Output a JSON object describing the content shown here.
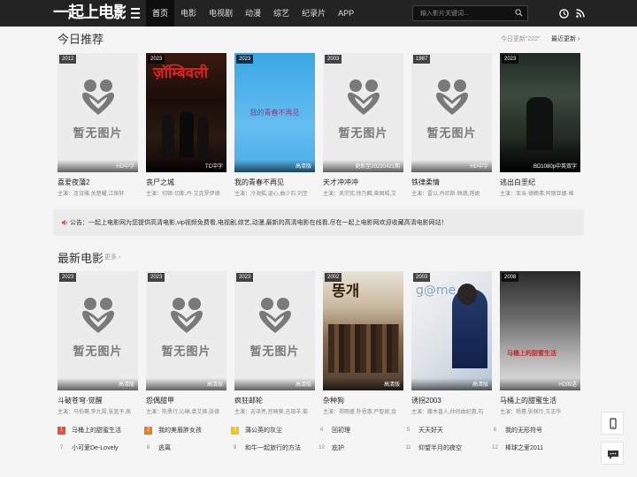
{
  "header": {
    "logo": "一起上电影",
    "nav": [
      "首页",
      "电影",
      "电视剧",
      "动漫",
      "综艺",
      "纪录片",
      "APP"
    ],
    "search_placeholder": "输入影片关键词..."
  },
  "today": {
    "title": "今日推荐",
    "hint": "今日更新\"222\"",
    "latest_link": "最近更新 ›",
    "cards": [
      {
        "year": "2012",
        "quality": "HD中字",
        "title": "喜爱夜蒲2",
        "cast": "主演：连诗雅,关楚耀,江佩轩",
        "poster": "none"
      },
      {
        "year": "2023",
        "quality": "TC中字",
        "title": "丧尸之城",
        "cast": "主演：切顿·切斯,丹·艾克罗伊德",
        "poster": "dark"
      },
      {
        "year": "2023",
        "quality": "高清版",
        "title": "我的青春不再见",
        "cast": "主演：冷海狐,温心,曲少石,刘至",
        "poster": "blue",
        "poster_text": "我的青春不再见"
      },
      {
        "year": "2003",
        "quality": "更新至20230421期",
        "title": "天才冲冲冲",
        "cast": "主演：吴宗宪,徐乃麟,曾国城,艾",
        "poster": "none"
      },
      {
        "year": "1987",
        "quality": "HD中字",
        "title": "铁律柔情",
        "cast": "主演：雷以,丹尼斯·佩德,莲妮",
        "poster": "none"
      },
      {
        "year": "2023",
        "quality": "BD1080p中英双字",
        "title": "逃出白垩纪",
        "cast": "主演：亚当·德赖弗,阿丽亚娜·格",
        "poster": "jungle"
      }
    ]
  },
  "notice": "公告：一起上电影网为您提供高清电影,vip视频免费看,电视剧,综艺,动漫,最新的高清电影在线看,尽在一起上电影网欢迎收藏高清电影网站！",
  "latest": {
    "title": "最新电影",
    "more": "更多 ›",
    "cards": [
      {
        "year": "2023",
        "quality": "高清版",
        "title": "斗破苍穹·觉醒",
        "cast": "主演：马伯骞,李九霄,张蓝予,高",
        "poster": "none"
      },
      {
        "year": "2023",
        "quality": "高清版",
        "title": "怨偶甜甲",
        "cast": "主演：陈勇行,沁琳,袁艾姬,张德",
        "poster": "none"
      },
      {
        "year": "2023",
        "quality": "高清版",
        "title": "疯狂邮轮",
        "cast": "主演：吉泽亮,宫崎葵,吉田羊,菊",
        "poster": "none"
      },
      {
        "year": "2002",
        "quality": "高清版",
        "title": "杂种狗",
        "cast": "主演：郑雨盛,朴恩惠,严智妮,金",
        "poster": "crowd",
        "poster_text": "똥개"
      },
      {
        "year": "2003",
        "quality": "高清版",
        "title": "诱拐2003",
        "cast": "主演：藤木直人,仲间由纪惠,石",
        "poster": "white",
        "poster_text": "g@me."
      },
      {
        "year": "2008",
        "quality": "HD国语",
        "title": "马桶上的甜蜜生活",
        "cast": "主演：杨蕙,张佩玲,王志华",
        "poster": "old",
        "poster_text": "马桶上的甜蜜生活"
      }
    ]
  },
  "noimg_text": "暂无图片",
  "ranking": [
    {
      "num": "1",
      "label": "马桶上的甜蜜生活",
      "color": "#e74c3c"
    },
    {
      "num": "2",
      "label": "我的美眉胖女孩",
      "color": "#e67e22"
    },
    {
      "num": "3",
      "label": "蒲公英的灰尘",
      "color": "#f1c40f"
    },
    {
      "num": "4",
      "label": "回初理",
      "color": ""
    },
    {
      "num": "5",
      "label": "天天好天",
      "color": ""
    },
    {
      "num": "6",
      "label": "我的无形符号",
      "color": ""
    },
    {
      "num": "7",
      "label": "小可爱De-Lovely",
      "color": ""
    },
    {
      "num": "8",
      "label": "逃离",
      "color": ""
    },
    {
      "num": "9",
      "label": "和牛一起旅行的方法",
      "color": ""
    },
    {
      "num": "10",
      "label": "庇护",
      "color": ""
    },
    {
      "num": "11",
      "label": "仰望半月的夜空",
      "color": ""
    },
    {
      "num": "12",
      "label": "棒球之爱2011",
      "color": ""
    }
  ]
}
